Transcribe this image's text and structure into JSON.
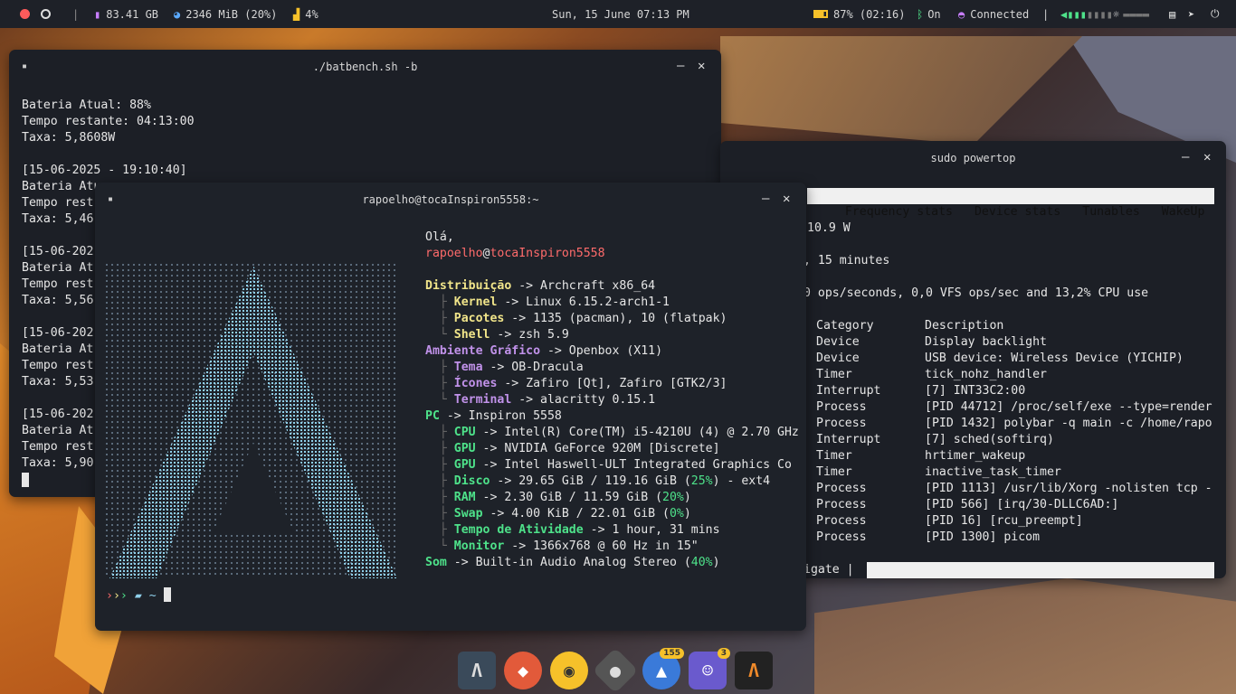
{
  "topbar": {
    "storage": "83.41 GB",
    "memory": "2346 MiB (20%)",
    "cpu": "4%",
    "clock": "Sun, 15 June 07:13 PM",
    "battery": "87% (02:16)",
    "bluetooth": "On",
    "wifi": "Connected",
    "separator": "|"
  },
  "batbench": {
    "title": "./batbench.sh -b",
    "lines": [
      "Bateria Atual: 88%",
      "Tempo restante: 04:13:00",
      "Taxa: 5,8608W",
      "",
      "[15-06-2025 - 19:10:40]",
      "Bateria Atu",
      "Tempo rest",
      "Taxa: 5,46",
      "",
      "[15-06-202",
      "Bateria At",
      "Tempo rest",
      "Taxa: 5,56",
      "",
      "[15-06-202",
      "Bateria At",
      "Tempo rest",
      "Taxa: 5,53",
      "",
      "[15-06-202",
      "Bateria At",
      "Tempo rest",
      "Taxa: 5,90"
    ]
  },
  "powertop": {
    "title": "sudo powertop",
    "tabs": [
      "Frequency stats",
      "Device stats",
      "Tunables",
      "WakeUp"
    ],
    "line1": "10.9 W",
    "line2": ", 15 minutes",
    "line3": "0 ops/seconds, 0,0 VFS ops/sec and 13,2% CPU use",
    "header": {
      "category": "Category",
      "description": "Description"
    },
    "rows": [
      [
        "Device",
        "Display backlight"
      ],
      [
        "Device",
        "USB device: Wireless Device (YICHIP)"
      ],
      [
        "Timer",
        "tick_nohz_handler"
      ],
      [
        "Interrupt",
        "[7] INT33C2:00"
      ],
      [
        "Process",
        "[PID 44712] /proc/self/exe --type=render"
      ],
      [
        "Process",
        "[PID 1432] polybar -q main -c /home/rapo"
      ],
      [
        "Interrupt",
        "[7] sched(softirq)"
      ],
      [
        "Timer",
        "hrtimer_wakeup"
      ],
      [
        "Timer",
        "inactive_task_timer"
      ],
      [
        "Process",
        "[PID 1113] /usr/lib/Xorg -nolisten tcp -"
      ],
      [
        "Process",
        "[PID 566] [irq/30-DLLC6AD:]"
      ],
      [
        "Process",
        "[PID 16] [rcu_preempt]"
      ],
      [
        "Process",
        "[PID 1300] picom"
      ]
    ],
    "footer": "igate |"
  },
  "fetch": {
    "title": "rapoelho@tocaInspiron5558:~",
    "greeting": "Olá,",
    "user": "rapoelho",
    "at": "@",
    "host": "tocaInspiron5558",
    "items": [
      {
        "k": "Distribuição",
        "v": " -> Archcraft x86_64",
        "cls": "yellow",
        "tree": ""
      },
      {
        "k": "Kernel",
        "v": " -> Linux 6.15.2-arch1-1",
        "cls": "yellow",
        "tree": "  ├ "
      },
      {
        "k": "Pacotes",
        "v": " -> 1135 (pacman), 10 (flatpak)",
        "cls": "yellow",
        "tree": "  ├ "
      },
      {
        "k": "Shell",
        "v": " -> zsh 5.9",
        "cls": "yellow",
        "tree": "  └ "
      },
      {
        "k": "Ambiente Gráfico",
        "v": " -> Openbox (X11)",
        "cls": "purple",
        "tree": ""
      },
      {
        "k": "Tema",
        "v": " -> OB-Dracula",
        "cls": "purple",
        "tree": "  ├ "
      },
      {
        "k": "Ícones",
        "v": " -> Zafiro [Qt], Zafiro [GTK2/3]",
        "cls": "purple",
        "tree": "  ├ "
      },
      {
        "k": "Terminal",
        "v": " -> alacritty 0.15.1",
        "cls": "purple",
        "tree": "  └ "
      },
      {
        "k": "PC",
        "v": " -> Inspiron 5558",
        "cls": "green",
        "tree": ""
      },
      {
        "k": "CPU",
        "v": " -> Intel(R) Core(TM) i5-4210U (4) @ 2.70 GHz",
        "cls": "green",
        "tree": "  ├ "
      },
      {
        "k": "GPU",
        "v": " -> NVIDIA GeForce 920M [Discrete]",
        "cls": "green",
        "tree": "  ├ "
      },
      {
        "k": "GPU",
        "v": " -> Intel Haswell-ULT Integrated Graphics Co",
        "cls": "green",
        "tree": "  ├ "
      },
      {
        "k": "Disco",
        "v": " -> 29.65 GiB / 119.16 GiB (",
        "pct": "25%",
        "tail": ") - ext4",
        "cls": "green",
        "tree": "  ├ "
      },
      {
        "k": "RAM",
        "v": " -> 2.30 GiB / 11.59 GiB (",
        "pct": "20%",
        "tail": ")",
        "cls": "green",
        "tree": "  ├ "
      },
      {
        "k": "Swap",
        "v": " -> 4.00 KiB / 22.01 GiB (",
        "pct": "0%",
        "tail": ")",
        "cls": "green",
        "tree": "  ├ "
      },
      {
        "k": "Tempo de Atividade",
        "v": " -> 1 hour, 31 mins",
        "cls": "green",
        "tree": "  ├ "
      },
      {
        "k": "Monitor",
        "v": " -> 1366x768 @ 60 Hz in 15\"",
        "cls": "green",
        "tree": "  └ "
      },
      {
        "k": "Som",
        "v": " -> Built-in Audio Analog Stereo (",
        "pct": "40%",
        "tail": ")",
        "cls": "green",
        "tree": ""
      }
    ],
    "prompt": "~"
  },
  "dock": {
    "badges": [
      "155",
      "3"
    ]
  },
  "colors": {
    "bar": "#1e2128",
    "term": "#1c1f26",
    "accent": "#4ee28a"
  }
}
